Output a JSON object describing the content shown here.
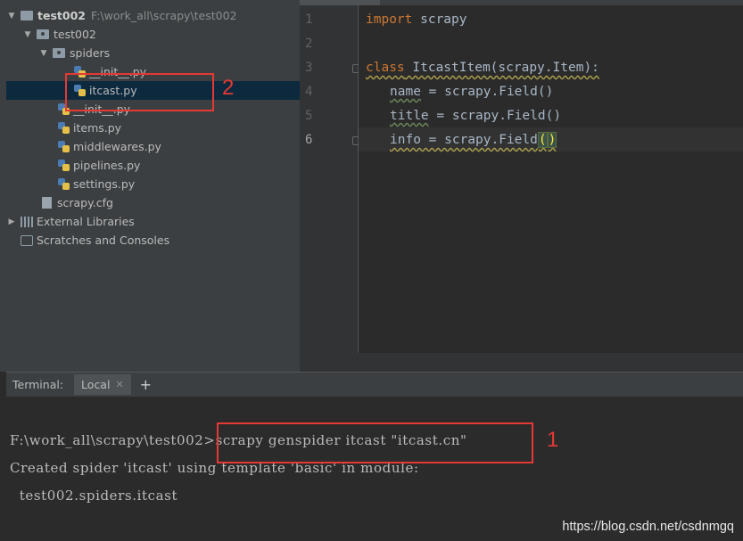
{
  "project_tree": {
    "root_name": "test002",
    "root_path": "F:\\work_all\\scrapy\\test002",
    "pkg_name": "test002",
    "spiders_name": "spiders",
    "spiders_init": "__init__.py",
    "spiders_itcast": "itcast.py",
    "pkg_init": "__init__.py",
    "items": "items.py",
    "middlewares": "middlewares.py",
    "pipelines": "pipelines.py",
    "settings": "settings.py",
    "scrapy_cfg": "scrapy.cfg",
    "external_libraries": "External Libraries",
    "scratches": "Scratches and Consoles"
  },
  "editor": {
    "line_numbers": [
      "1",
      "2",
      "3",
      "4",
      "5",
      "6"
    ],
    "line1_kw": "import",
    "line1_rest": " scrapy",
    "line3_kw": "class",
    "line3_rest": " ItcastItem(scrapy.Item):",
    "line4_attr": "name",
    "line4_rest": " = scrapy.Field()",
    "line5_attr": "title",
    "line5_rest": " = scrapy.Field()",
    "line6_attr": "info",
    "line6_rest": " = scrapy.Field",
    "line6_open": "(",
    "line6_close": ")"
  },
  "terminal": {
    "label": "Terminal:",
    "tab_local": "Local",
    "prompt": "F:\\work_all\\scrapy\\test002>",
    "command": "scrapy genspider itcast \"itcast.cn\"",
    "output1": "Created spider 'itcast' using template 'basic' in module:",
    "output2": "  test002.spiders.itcast"
  },
  "annotations": {
    "box1_number": "1",
    "box2_number": "2",
    "color": "#e53935"
  },
  "watermark": "https://blog.csdn.net/csdnmgq"
}
